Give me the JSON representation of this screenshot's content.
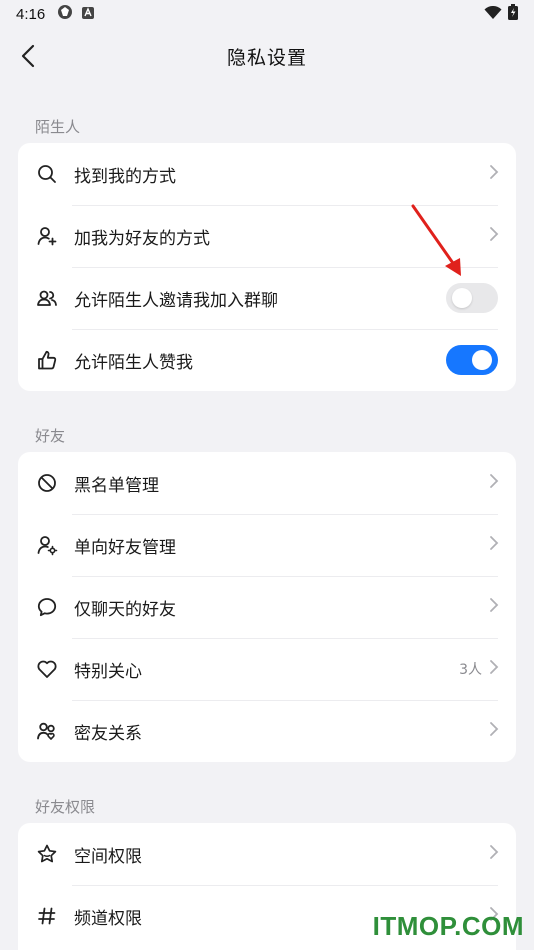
{
  "status_bar": {
    "time": "4:16"
  },
  "nav": {
    "title": "隐私设置"
  },
  "sections": {
    "strangers": {
      "label": "陌生人",
      "items": [
        {
          "label": "找到我的方式"
        },
        {
          "label": "加我为好友的方式"
        },
        {
          "label": "允许陌生人邀请我加入群聊",
          "toggle": "off"
        },
        {
          "label": "允许陌生人赞我",
          "toggle": "on"
        }
      ]
    },
    "friends": {
      "label": "好友",
      "items": [
        {
          "label": "黑名单管理"
        },
        {
          "label": "单向好友管理"
        },
        {
          "label": "仅聊天的好友"
        },
        {
          "label": "特别关心",
          "value": "3人"
        },
        {
          "label": "密友关系"
        }
      ]
    },
    "friend_permissions": {
      "label": "好友权限",
      "items": [
        {
          "label": "空间权限"
        },
        {
          "label": "频道权限"
        }
      ]
    }
  },
  "watermark": {
    "text": "ITMOP.COM"
  },
  "colors": {
    "accent": "#1677ff",
    "background": "#f2f2f5",
    "annotation_arrow": "#e0211c"
  }
}
